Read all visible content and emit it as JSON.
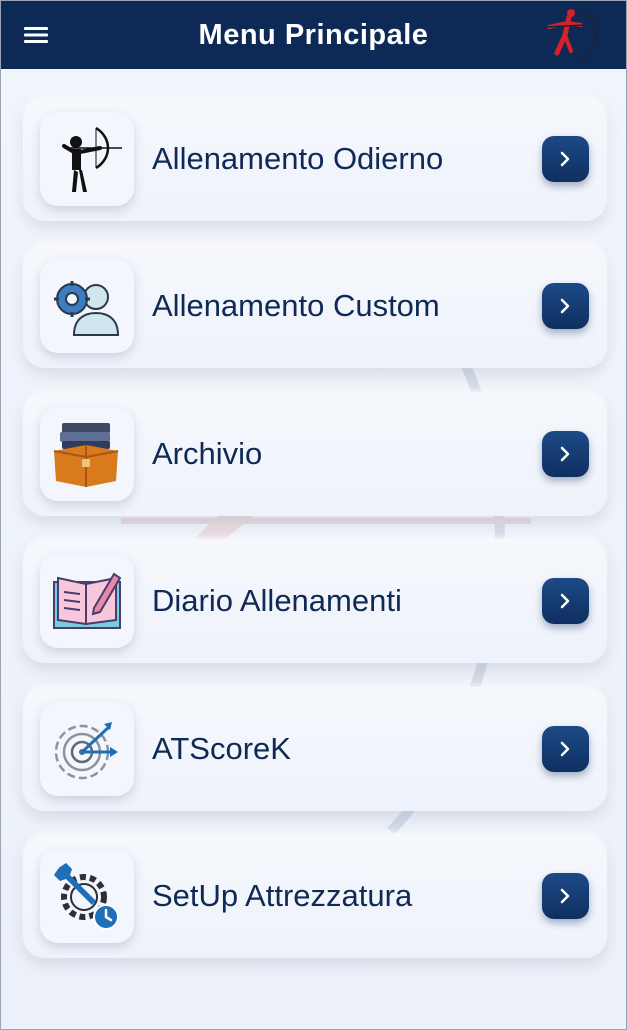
{
  "header": {
    "title": "Menu Principale",
    "menu_icon": "hamburger-menu-icon",
    "logo_icon": "archer-logo-icon",
    "background_color": "#0d2a57"
  },
  "menu": {
    "items": [
      {
        "label": "Allenamento Odierno",
        "icon": "archer-icon"
      },
      {
        "label": "Allenamento Custom",
        "icon": "user-settings-icon"
      },
      {
        "label": "Archivio",
        "icon": "archive-box-icon"
      },
      {
        "label": "Diario Allenamenti",
        "icon": "diary-book-icon"
      },
      {
        "label": "ATScoreK",
        "icon": "target-arrows-icon"
      },
      {
        "label": "SetUp Attrezzatura",
        "icon": "wrench-gear-icon"
      }
    ],
    "chevron_icon": "chevron-right-icon",
    "accent_color": "#0f2f60",
    "text_color": "#0f2a55"
  }
}
